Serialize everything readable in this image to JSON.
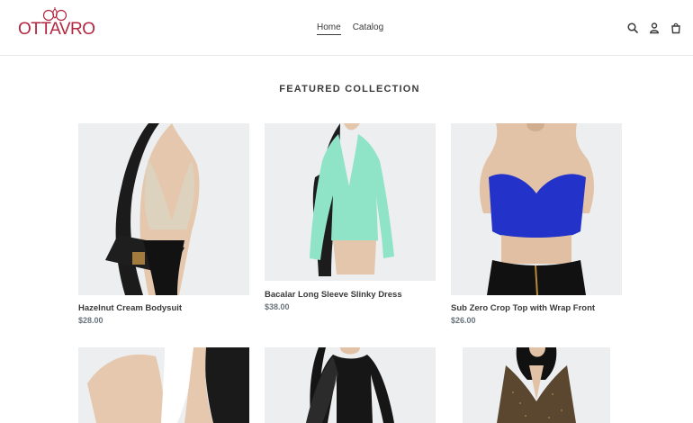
{
  "brand": {
    "name": "OTTAVRO",
    "color": "#b3263f"
  },
  "nav": {
    "items": [
      {
        "label": "Home",
        "active": true
      },
      {
        "label": "Catalog",
        "active": false
      }
    ]
  },
  "header_icons": [
    "search-icon",
    "account-icon",
    "cart-icon"
  ],
  "section": {
    "title": "FEATURED COLLECTION"
  },
  "products": [
    {
      "name": "Hazelnut Cream Bodysuit",
      "price": "$28.00"
    },
    {
      "name": "Bacalar Long Sleeve Slinky Dress",
      "price": "$38.00"
    },
    {
      "name": "Sub Zero Crop Top with Wrap Front",
      "price": "$26.00"
    },
    {
      "name": "",
      "price": ""
    },
    {
      "name": "",
      "price": ""
    },
    {
      "name": "",
      "price": ""
    }
  ]
}
